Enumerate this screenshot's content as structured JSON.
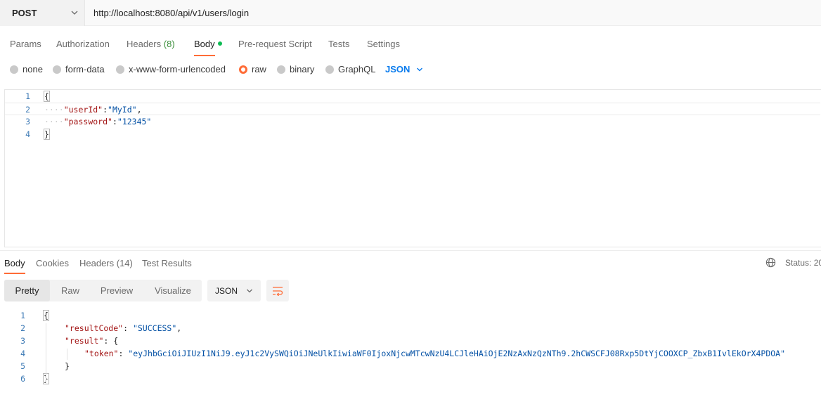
{
  "request": {
    "method": "POST",
    "url": "http://localhost:8080/api/v1/users/login"
  },
  "request_tabs": {
    "params": "Params",
    "authorization": "Authorization",
    "headers": "Headers",
    "headers_count": "(8)",
    "body": "Body",
    "pre_request": "Pre-request Script",
    "tests": "Tests",
    "settings": "Settings"
  },
  "body_types": {
    "none": "none",
    "form_data": "form-data",
    "urlencoded": "x-www-form-urlencoded",
    "raw": "raw",
    "binary": "binary",
    "graphql": "GraphQL",
    "selected_language": "JSON"
  },
  "request_body": {
    "lines": [
      {
        "n": "1",
        "open": "{"
      },
      {
        "n": "2",
        "key": "\"userId\"",
        "sep": ":",
        "val": "\"MyId\"",
        "end": ","
      },
      {
        "n": "3",
        "key": "\"password\"",
        "sep": ":",
        "val": "\"12345\"",
        "end": ""
      },
      {
        "n": "4",
        "close": "}"
      }
    ]
  },
  "response_tabs": {
    "body": "Body",
    "cookies": "Cookies",
    "headers": "Headers (14)",
    "test_results": "Test Results",
    "status": "Status: 20"
  },
  "response_view": {
    "pretty": "Pretty",
    "raw": "Raw",
    "preview": "Preview",
    "visualize": "Visualize",
    "format": "JSON"
  },
  "response_body": {
    "l1": {
      "n": "1",
      "text": "{"
    },
    "l2": {
      "n": "2",
      "key": "\"resultCode\"",
      "sep": ": ",
      "val": "\"SUCCESS\"",
      "end": ","
    },
    "l3": {
      "n": "3",
      "key": "\"result\"",
      "sep": ": ",
      "open": "{"
    },
    "l4": {
      "n": "4",
      "key": "\"token\"",
      "sep": ": ",
      "val": "\"eyJhbGciOiJIUzI1NiJ9.eyJ1c2VySWQiOiJNeUlkIiwiaWF0IjoxNjcwMTcwNzU4LCJleHAiOjE2NzAxNzQzNTh9.2hCWSCFJ08Rxp5DtYjCOOXCP_ZbxB1IvlEkOrX4PDOA\""
    },
    "l5": {
      "n": "5",
      "text": "}"
    },
    "l6": {
      "n": "6",
      "text": "}"
    }
  },
  "colors": {
    "accent": "#ff6c37",
    "link_blue": "#097bed",
    "active_dot": "#0cbb52"
  }
}
